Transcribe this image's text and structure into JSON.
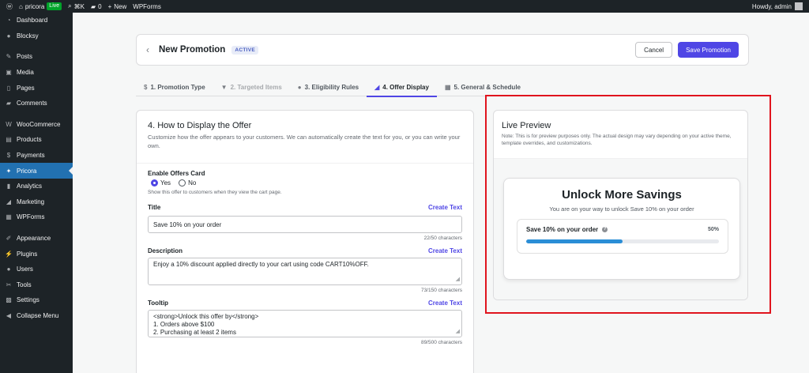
{
  "admin_bar": {
    "site_name": "pricora",
    "live_badge": "Live",
    "shortcut": "⌘K",
    "comments_count": "0",
    "new_label": "New",
    "wpforms": "WPForms",
    "howdy": "Howdy, admin"
  },
  "sidebar": {
    "items": [
      {
        "label": "Dashboard",
        "icon": "dashboard-icon",
        "glyph": "◔"
      },
      {
        "label": "Blocksy",
        "icon": "blocksy-icon",
        "glyph": "●"
      },
      {
        "label": "Posts",
        "icon": "pin-icon",
        "glyph": "✎"
      },
      {
        "label": "Media",
        "icon": "media-icon",
        "glyph": "▣"
      },
      {
        "label": "Pages",
        "icon": "page-icon",
        "glyph": "▯"
      },
      {
        "label": "Comments",
        "icon": "comment-icon",
        "glyph": "▰"
      },
      {
        "label": "WooCommerce",
        "icon": "woocommerce-icon",
        "glyph": "W"
      },
      {
        "label": "Products",
        "icon": "box-icon",
        "glyph": "▤"
      },
      {
        "label": "Payments",
        "icon": "dollar-icon",
        "glyph": "$"
      },
      {
        "label": "Pricora",
        "icon": "tag-icon",
        "glyph": "✦"
      },
      {
        "label": "Analytics",
        "icon": "chart-icon",
        "glyph": "▮"
      },
      {
        "label": "Marketing",
        "icon": "megaphone-icon",
        "glyph": "◢"
      },
      {
        "label": "WPForms",
        "icon": "form-icon",
        "glyph": "▦"
      },
      {
        "label": "Appearance",
        "icon": "brush-icon",
        "glyph": "✐"
      },
      {
        "label": "Plugins",
        "icon": "plug-icon",
        "glyph": "⚡"
      },
      {
        "label": "Users",
        "icon": "user-icon",
        "glyph": "●"
      },
      {
        "label": "Tools",
        "icon": "wrench-icon",
        "glyph": "✂"
      },
      {
        "label": "Settings",
        "icon": "settings-icon",
        "glyph": "▩"
      },
      {
        "label": "Collapse Menu",
        "icon": "collapse-icon",
        "glyph": "◀"
      }
    ]
  },
  "header": {
    "title": "New Promotion",
    "status": "ACTIVE",
    "cancel_label": "Cancel",
    "save_label": "Save Promotion"
  },
  "tabs": [
    {
      "label": "1. Promotion Type",
      "glyph": "$"
    },
    {
      "label": "2. Targeted Items",
      "glyph": "▼"
    },
    {
      "label": "3. Eligibility Rules",
      "glyph": "●"
    },
    {
      "label": "4. Offer Display",
      "glyph": "◢"
    },
    {
      "label": "5. General & Schedule",
      "glyph": "▦"
    }
  ],
  "form": {
    "heading": "4. How to Display the Offer",
    "intro": "Customize how the offer appears to your customers. We can automatically create the text for you, or you can write your own.",
    "enable_label": "Enable Offers Card",
    "yes_label": "Yes",
    "no_label": "No",
    "enable_hint": "Show this offer to customers when they view the cart page.",
    "title_label": "Title",
    "create_text": "Create Text",
    "title_value": "Save 10% on your order",
    "title_count": "22/50 characters",
    "desc_label": "Description",
    "desc_value": "Enjoy a 10% discount applied directly to your cart using code CART10%OFF.",
    "desc_count": "73/150 characters",
    "tooltip_label": "Tooltip",
    "tooltip_line1": "<strong>Unlock this offer by</strong>",
    "tooltip_line2": "1. Orders above $100",
    "tooltip_line3": "2. Purchasing at least 2 items",
    "tooltip_count": "89/500 characters"
  },
  "preview": {
    "heading": "Live Preview",
    "note": "Note: This is for preview purposes only. The actual design may vary depending on your active theme, template overrides, and customizations.",
    "card_title": "Unlock More Savings",
    "card_subtitle": "You are on your way to unlock Save 10% on your order",
    "progress_label": "Save 10% on your order",
    "progress_percent": "50%",
    "progress_value": 0.5
  },
  "colors": {
    "accent": "#4f46e5",
    "highlight": "#e0141e",
    "progress": "#2b8ed6"
  }
}
